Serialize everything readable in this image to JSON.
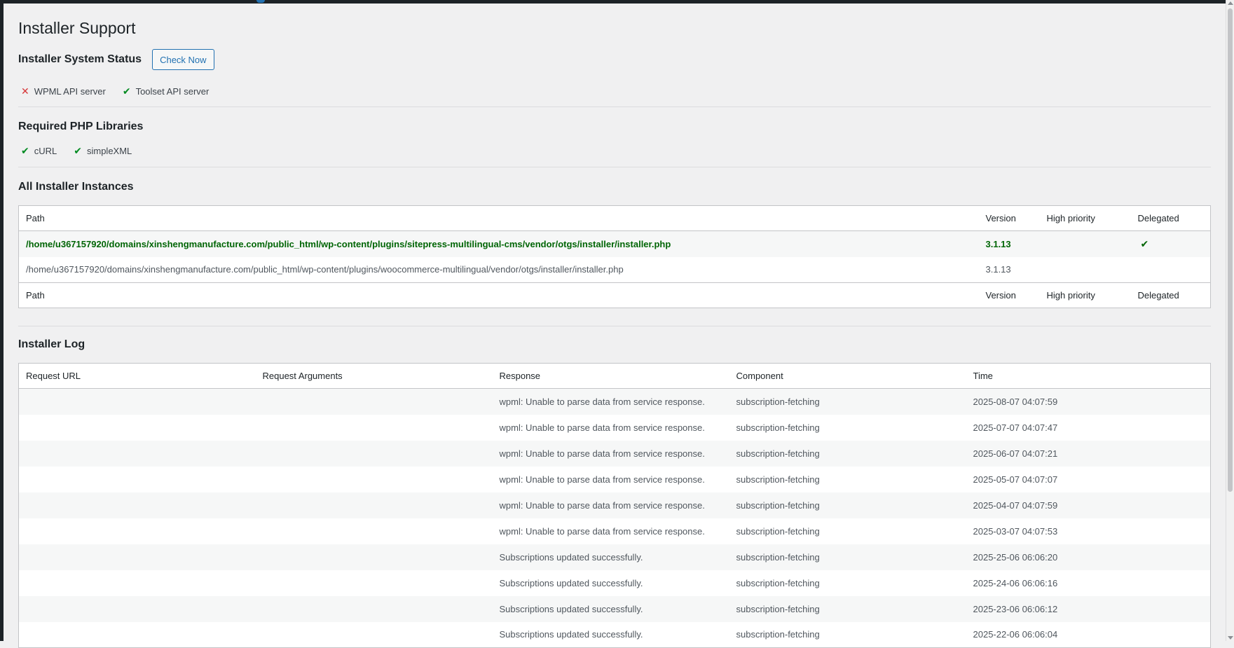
{
  "page": {
    "title": "Installer Support"
  },
  "system_status": {
    "heading": "Installer System Status",
    "check_button": "Check Now",
    "servers": [
      {
        "label": "WPML API server",
        "state": "fail",
        "icon": "cross-icon"
      },
      {
        "label": "Toolset API server",
        "state": "ok",
        "icon": "check-icon"
      }
    ]
  },
  "php_libraries": {
    "heading": "Required PHP Libraries",
    "items": [
      {
        "label": "cURL",
        "state": "ok"
      },
      {
        "label": "simpleXML",
        "state": "ok"
      }
    ]
  },
  "instances": {
    "heading": "All Installer Instances",
    "columns": [
      "Path",
      "Version",
      "High priority",
      "Delegated"
    ],
    "rows": [
      {
        "path": "/home/u367157920/domains/xinshengmanufacture.com/public_html/wp-content/plugins/sitepress-multilingual-cms/vendor/otgs/installer/installer.php",
        "version": "3.1.13",
        "high_priority": "",
        "delegated": "✔",
        "active": true
      },
      {
        "path": "/home/u367157920/domains/xinshengmanufacture.com/public_html/wp-content/plugins/woocommerce-multilingual/vendor/otgs/installer/installer.php",
        "version": "3.1.13",
        "high_priority": "",
        "delegated": "",
        "active": false
      }
    ]
  },
  "log": {
    "heading": "Installer Log",
    "columns": [
      "Request URL",
      "Request Arguments",
      "Response",
      "Component",
      "Time"
    ],
    "rows": [
      {
        "url": "",
        "args": "",
        "response": "wpml: Unable to parse data from service response.",
        "component": "subscription-fetching",
        "time": "2025-08-07 04:07:59"
      },
      {
        "url": "",
        "args": "",
        "response": "wpml: Unable to parse data from service response.",
        "component": "subscription-fetching",
        "time": "2025-07-07 04:07:47"
      },
      {
        "url": "",
        "args": "",
        "response": "wpml: Unable to parse data from service response.",
        "component": "subscription-fetching",
        "time": "2025-06-07 04:07:21"
      },
      {
        "url": "",
        "args": "",
        "response": "wpml: Unable to parse data from service response.",
        "component": "subscription-fetching",
        "time": "2025-05-07 04:07:07"
      },
      {
        "url": "",
        "args": "",
        "response": "wpml: Unable to parse data from service response.",
        "component": "subscription-fetching",
        "time": "2025-04-07 04:07:59"
      },
      {
        "url": "",
        "args": "",
        "response": "wpml: Unable to parse data from service response.",
        "component": "subscription-fetching",
        "time": "2025-03-07 04:07:53"
      },
      {
        "url": "",
        "args": "",
        "response": "Subscriptions updated successfully.",
        "component": "subscription-fetching",
        "time": "2025-25-06 06:06:20"
      },
      {
        "url": "",
        "args": "",
        "response": "Subscriptions updated successfully.",
        "component": "subscription-fetching",
        "time": "2025-24-06 06:06:16"
      },
      {
        "url": "",
        "args": "",
        "response": "Subscriptions updated successfully.",
        "component": "subscription-fetching",
        "time": "2025-23-06 06:06:12"
      },
      {
        "url": "",
        "args": "",
        "response": "Subscriptions updated successfully.",
        "component": "subscription-fetching",
        "time": "2025-22-06 06:06:04"
      }
    ]
  },
  "colors": {
    "ok": "#008a20",
    "fail": "#d63638",
    "accent": "#2271b1",
    "active_row": "#006505"
  }
}
